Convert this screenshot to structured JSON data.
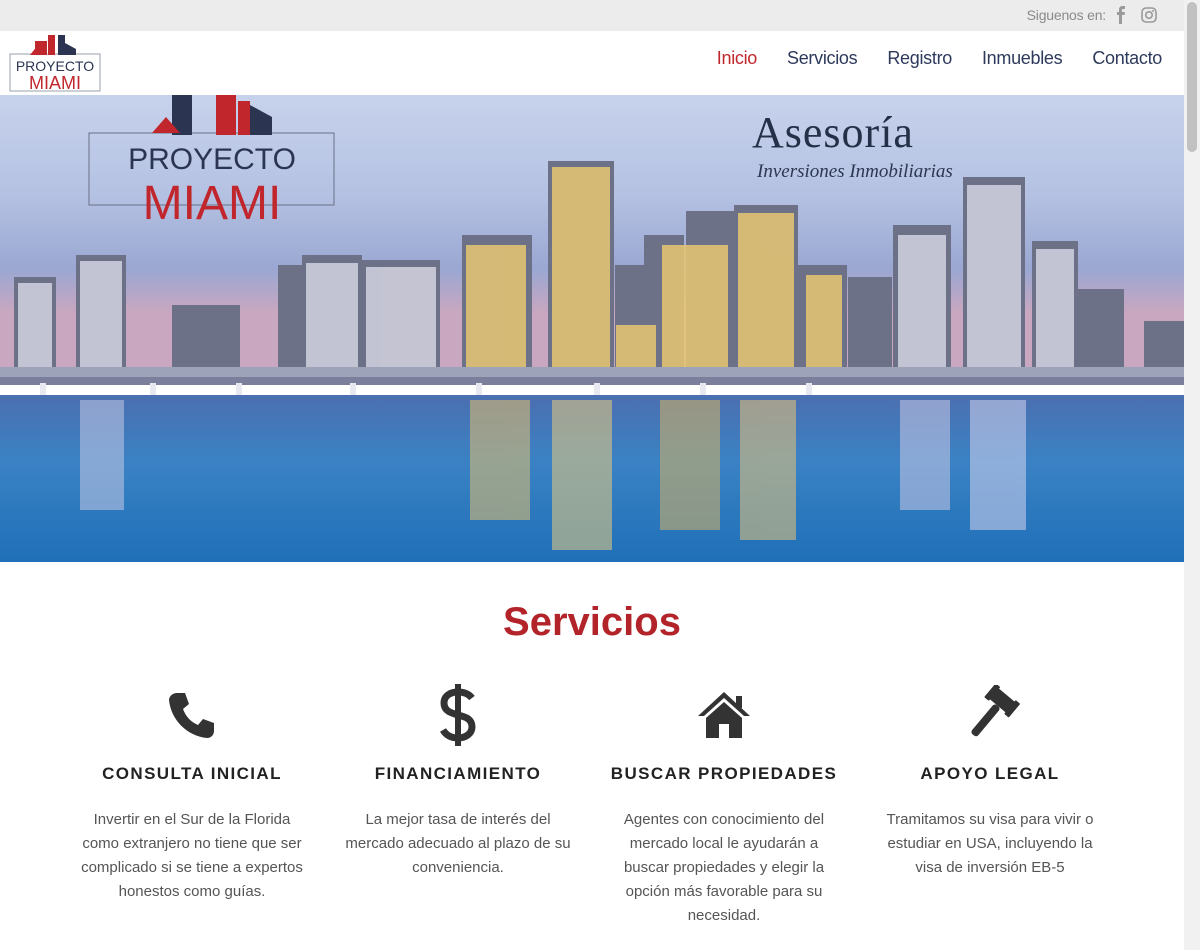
{
  "topbar": {
    "follow_label": "Siguenos en:",
    "icons": [
      "facebook-icon",
      "instagram-icon"
    ]
  },
  "brand": {
    "logo_line1": "PROYECTO",
    "logo_line2": "MIAMI"
  },
  "nav": {
    "items": [
      {
        "label": "Inicio",
        "active": true
      },
      {
        "label": "Servicios",
        "active": false
      },
      {
        "label": "Registro",
        "active": false
      },
      {
        "label": "Inmuebles",
        "active": false
      },
      {
        "label": "Contacto",
        "active": false
      }
    ]
  },
  "hero": {
    "logo_line1": "PROYECTO",
    "logo_line2": "MIAMI",
    "title": "Asesoría",
    "subtitle": "Inversiones Inmobiliarias"
  },
  "services": {
    "heading": "Servicios",
    "items": [
      {
        "icon": "phone-icon",
        "title": "CONSULTA INICIAL",
        "text": "Invertir en el Sur de la Florida como extranjero no tiene que ser complicado si se tiene a expertos honestos como guías."
      },
      {
        "icon": "dollar-icon",
        "title": "FINANCIAMIENTO",
        "text": "La mejor tasa de interés del mercado adecuado al plazo de su conveniencia."
      },
      {
        "icon": "home-icon",
        "title": "BUSCAR PROPIEDADES",
        "text": "Agentes con conocimiento del mercado local le ayudarán a buscar propiedades y elegir la opción más favorable para su necesidad."
      },
      {
        "icon": "gavel-icon",
        "title": "APOYO LEGAL",
        "text": "Tramitamos su visa para vivir o estudiar en USA, incluyendo la visa de inversión EB-5"
      }
    ]
  },
  "colors": {
    "brand_red": "#c0262c",
    "nav_blue": "#2e3a5c",
    "heading_red": "#b3242a"
  }
}
